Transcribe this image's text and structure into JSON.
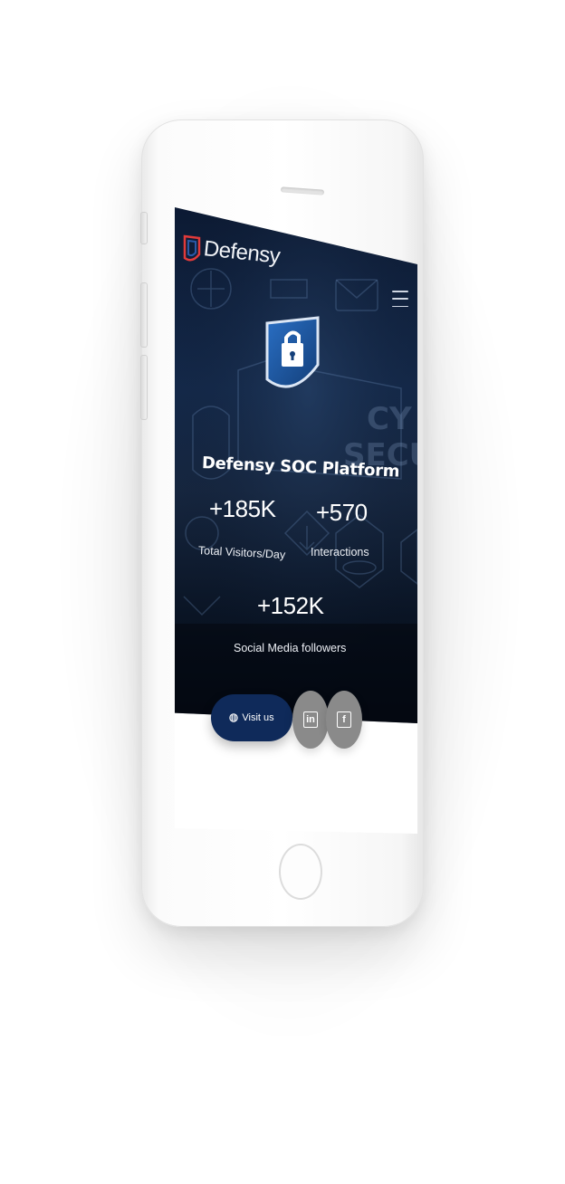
{
  "brand": {
    "name": "Defensy",
    "logo_color": "#e03a3a"
  },
  "colors": {
    "hero_dark": "#0c1a33",
    "accent_blue": "#1a4c8b",
    "button_navy": "#0f2a5a",
    "social_gray": "#8a8a8a"
  },
  "header": {
    "menu_icon": "hamburger-icon"
  },
  "hero": {
    "badge_icon": "shield-lock-icon",
    "title": "Defensy SOC Platform",
    "stats": [
      {
        "value": "+185K",
        "label": "Total Visitors/Day"
      },
      {
        "value": "+570",
        "label": "Interactions"
      },
      {
        "value": "+152K",
        "label": "Social Media followers"
      }
    ]
  },
  "actions": {
    "visit_label": "Visit us",
    "visit_icon": "globe-icon",
    "social": [
      {
        "name": "linkedin",
        "glyph": "in"
      },
      {
        "name": "facebook",
        "glyph": "f"
      }
    ]
  }
}
